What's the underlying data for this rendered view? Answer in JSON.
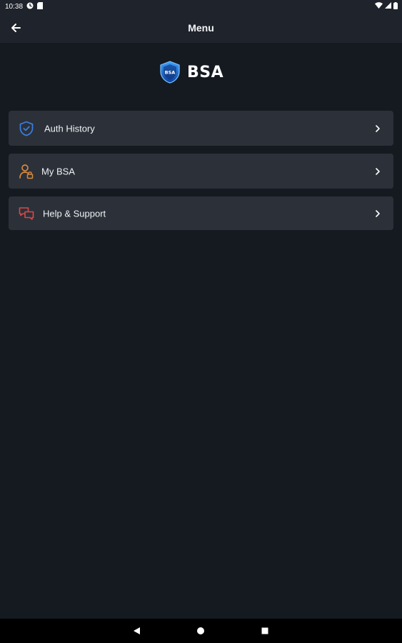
{
  "status_bar": {
    "time": "10:38"
  },
  "app_bar": {
    "title": "Menu"
  },
  "logo": {
    "text": "BSA",
    "badge_text": "BSA"
  },
  "menu": {
    "items": [
      {
        "label": "Auth History",
        "icon": "shield-check-icon",
        "color": "#3a7ee0"
      },
      {
        "label": "My BSA",
        "icon": "user-lock-icon",
        "color": "#d98a3f"
      },
      {
        "label": "Help & Support",
        "icon": "chat-bubbles-icon",
        "color": "#d94848"
      }
    ]
  },
  "nav_bar": {
    "buttons": [
      "back-icon",
      "home-icon",
      "recents-icon"
    ]
  }
}
